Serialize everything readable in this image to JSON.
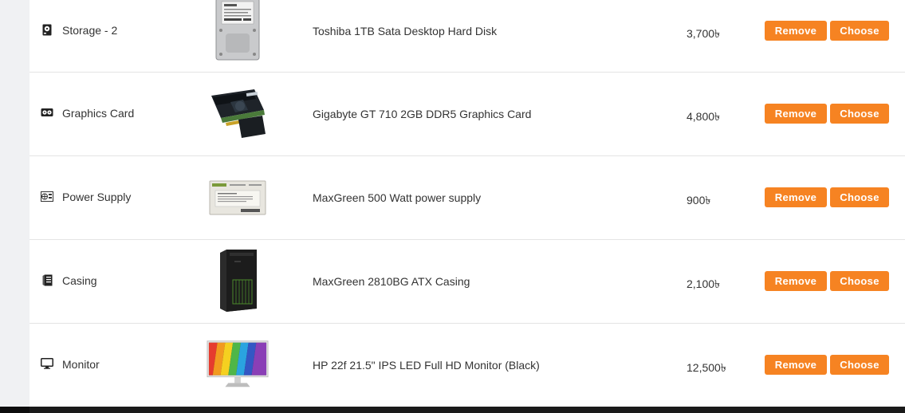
{
  "rows": [
    {
      "category": "Storage - 2",
      "category_icon": "hard-disk-icon",
      "product": "Toshiba 1TB Sata Desktop Hard Disk",
      "price": "3,700৳",
      "remove_label": "Remove",
      "choose_label": "Choose",
      "image": "hard-disk-image"
    },
    {
      "category": "Graphics Card",
      "category_icon": "graphics-card-icon",
      "product": "Gigabyte GT 710 2GB DDR5 Graphics Card",
      "price": "4,800৳",
      "remove_label": "Remove",
      "choose_label": "Choose",
      "image": "graphics-card-image"
    },
    {
      "category": "Power Supply",
      "category_icon": "power-supply-icon",
      "product": "MaxGreen 500 Watt power supply",
      "price": "900৳",
      "remove_label": "Remove",
      "choose_label": "Choose",
      "image": "power-supply-image"
    },
    {
      "category": "Casing",
      "category_icon": "casing-icon",
      "product": "MaxGreen 2810BG ATX Casing",
      "price": "2,100৳",
      "remove_label": "Remove",
      "choose_label": "Choose",
      "image": "casing-image"
    },
    {
      "category": "Monitor",
      "category_icon": "monitor-icon",
      "product": "HP 22f 21.5\" IPS LED Full HD Monitor (Black)",
      "price": "12,500৳",
      "remove_label": "Remove",
      "choose_label": "Choose",
      "image": "monitor-image"
    }
  ],
  "colors": {
    "button": "#f68322",
    "row_border": "#e4e4e4",
    "page_bg": "#f0f1f3"
  }
}
